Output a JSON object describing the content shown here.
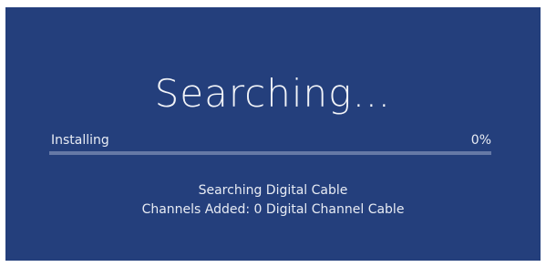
{
  "screen": {
    "title": "Searching…",
    "progress": {
      "label": "Installing",
      "percent_text": "0%",
      "fraction": 0
    },
    "status": {
      "line1": "Searching Digital Cable",
      "line2": "Channels Added: 0 Digital Channel Cable"
    }
  },
  "colors": {
    "background": "#243f7c",
    "track": "#6679a6",
    "text": "#ffffff"
  }
}
